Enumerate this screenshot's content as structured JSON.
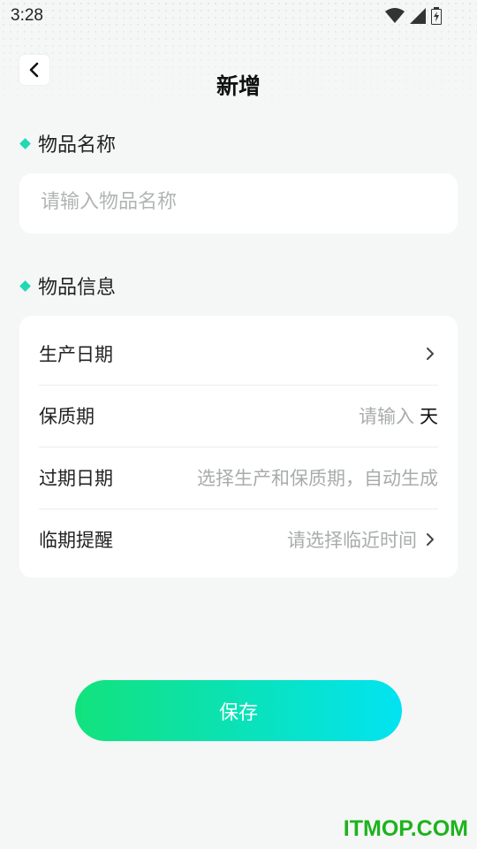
{
  "status_bar": {
    "time": "3:28"
  },
  "header": {
    "title": "新增"
  },
  "sections": {
    "name": {
      "title": "物品名称",
      "placeholder": "请输入物品名称"
    },
    "info": {
      "title": "物品信息"
    }
  },
  "form": {
    "production_date": {
      "label": "生产日期"
    },
    "shelf_life": {
      "label": "保质期",
      "placeholder": "请输入",
      "unit": "天"
    },
    "expiry_date": {
      "label": "过期日期",
      "hint": "选择生产和保质期，自动生成"
    },
    "reminder": {
      "label": "临期提醒",
      "placeholder": "请选择临近时间"
    }
  },
  "save_label": "保存",
  "watermark": "ITMOP.COM",
  "colors": {
    "accent": "#1fd9b4",
    "gradient_start": "#12e27c",
    "gradient_end": "#02e3f2"
  }
}
